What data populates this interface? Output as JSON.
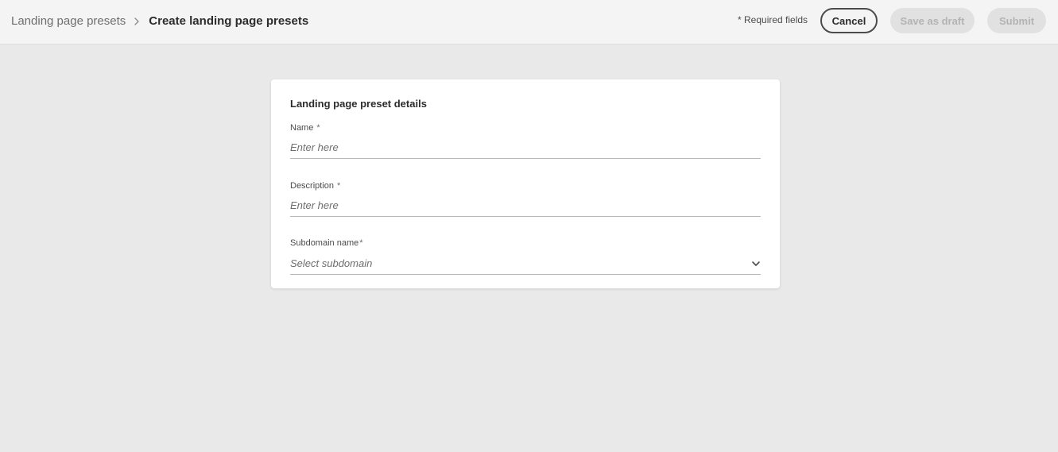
{
  "header": {
    "breadcrumb_parent": "Landing page presets",
    "breadcrumb_current": "Create landing page presets",
    "required_note": "* Required fields",
    "cancel_label": "Cancel",
    "save_draft_label": "Save as draft",
    "submit_label": "Submit"
  },
  "form": {
    "title": "Landing page preset details",
    "name": {
      "label": "Name",
      "required_mark": "*",
      "placeholder": "Enter here"
    },
    "description": {
      "label": "Description",
      "required_mark": "*",
      "placeholder": "Enter here"
    },
    "subdomain": {
      "label": "Subdomain name",
      "required_mark": "*",
      "placeholder": "Select subdomain"
    }
  },
  "icons": {
    "breadcrumb_separator": "chevron-right-icon",
    "subdomain_dropdown": "chevron-down-icon"
  },
  "colors": {
    "background": "#e9e9e9",
    "header_background": "#f4f4f4",
    "card_background": "#ffffff",
    "disabled_button_bg": "#e1e1e1",
    "disabled_button_text": "#b3b3b3"
  }
}
